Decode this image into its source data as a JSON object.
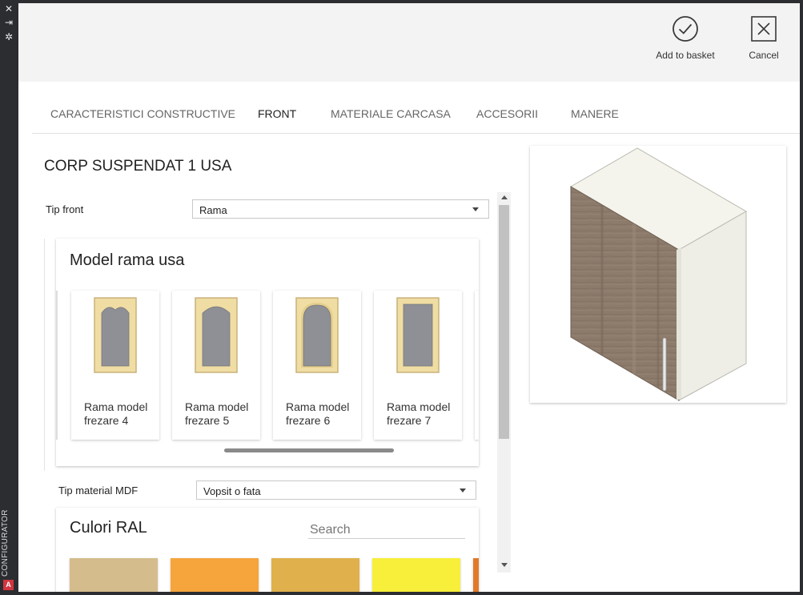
{
  "sidebar": {
    "icons": [
      "close-icon",
      "pin-icon",
      "gear-icon"
    ],
    "label": "CONFIGURATOR",
    "logo_text": "A"
  },
  "toolbar": {
    "add_label": "Add to basket",
    "cancel_label": "Cancel"
  },
  "tabs": [
    {
      "label": "CARACTERISTICI CONSTRUCTIVE",
      "active": false
    },
    {
      "label": "FRONT",
      "active": true
    },
    {
      "label": "MATERIALE CARCASA",
      "active": false
    },
    {
      "label": "ACCESORII",
      "active": false
    },
    {
      "label": "MANERE",
      "active": false
    }
  ],
  "main": {
    "title": "CORP SUSPENDAT 1 USA",
    "tip_front": {
      "label": "Tip front",
      "value": "Rama"
    },
    "model_panel": {
      "title": "Model rama usa",
      "cards": [
        {
          "line1": "Rama model",
          "line2": "frezare 4",
          "arch": "pointed"
        },
        {
          "line1": "Rama model",
          "line2": "frezare 5",
          "arch": "round"
        },
        {
          "line1": "Rama model",
          "line2": "frezare 6",
          "arch": "round"
        },
        {
          "line1": "Rama model",
          "line2": "frezare 7",
          "arch": "flat"
        }
      ]
    },
    "tip_material": {
      "label": "Tip material MDF",
      "value": "Vopsit o fata"
    },
    "ral_panel": {
      "title": "Culori RAL",
      "search_placeholder": "Search",
      "swatches": [
        "#d4bc8c",
        "#f5a53c",
        "#dfb04c",
        "#f7ef3a",
        "#e07a28"
      ]
    }
  },
  "colors": {
    "door_frame": "#f0dda3",
    "door_frame_border": "#c9b27a",
    "door_glass": "#8e9096",
    "wood": "#8c7a6b",
    "carcass": "#f2f2ea"
  }
}
